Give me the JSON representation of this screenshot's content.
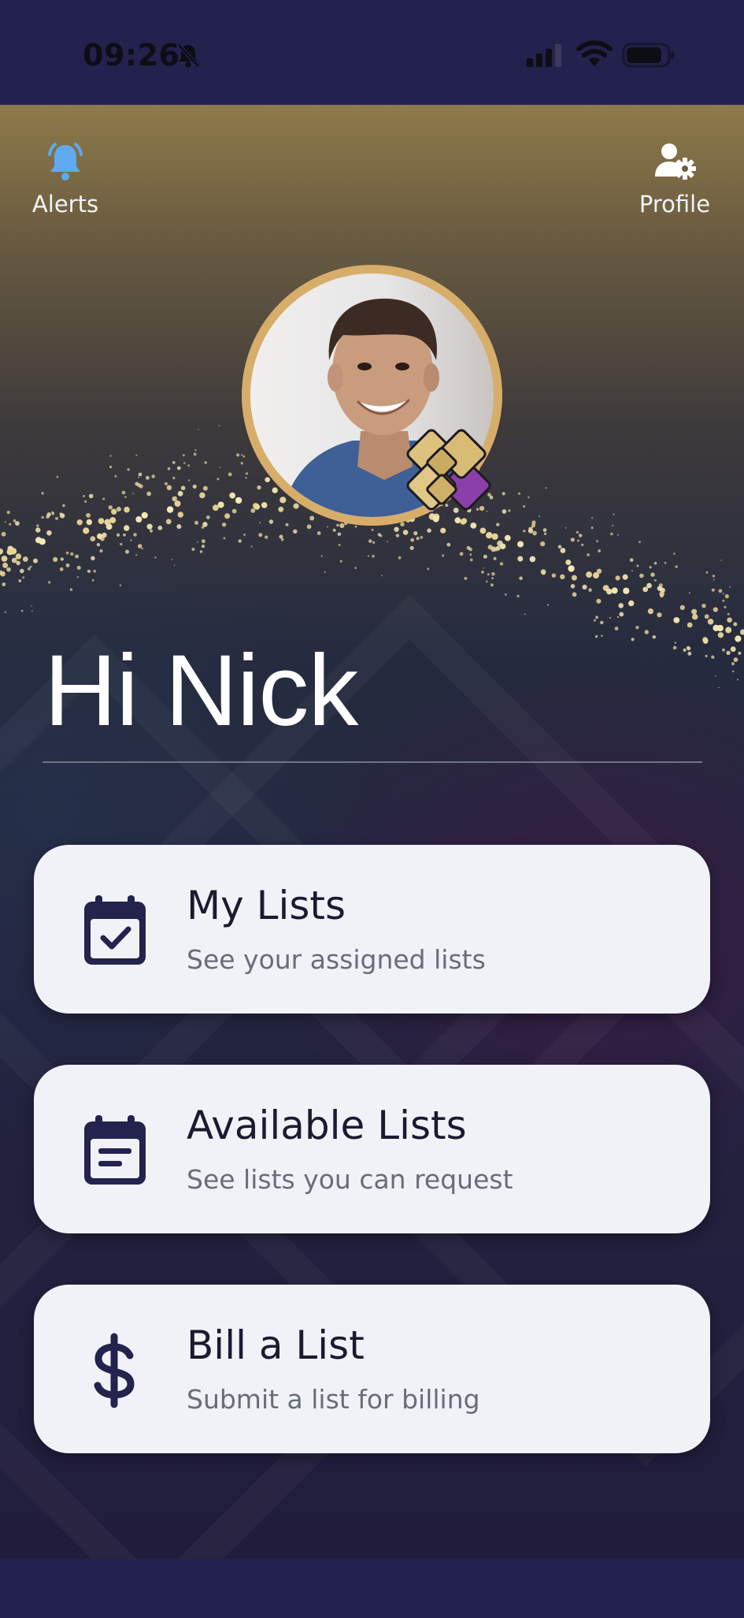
{
  "status_bar": {
    "time": "09:26",
    "icons": [
      "bell-slash-icon",
      "signal-icon",
      "wifi-icon",
      "battery-icon"
    ]
  },
  "nav": {
    "alerts_label": "Alerts",
    "profile_label": "Profile",
    "alerts_icon": "bell-icon",
    "profile_icon": "user-gear-icon"
  },
  "greeting": "Hi Nick",
  "cards": [
    {
      "title": "My Lists",
      "subtitle": "See your assigned lists",
      "icon": "calendar-check-icon"
    },
    {
      "title": "Available Lists",
      "subtitle": "See lists you can request",
      "icon": "calendar-list-icon"
    },
    {
      "title": "Bill a List",
      "subtitle": "Submit a list for billing",
      "icon": "dollar-icon"
    }
  ],
  "colors": {
    "status_bar_bg": "#23214e",
    "accent_gold": "#d7ad6a",
    "alert_blue": "#5fa9f0",
    "card_bg": "#f1f2f7",
    "icon_navy": "#23234e"
  }
}
